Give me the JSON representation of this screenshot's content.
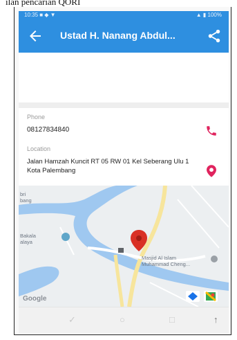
{
  "caption": "ılan pencarian QORI",
  "statusbar": {
    "left": "10:35 ■ ◆ ▼",
    "right": "▲ ▮ 100%"
  },
  "header": {
    "title": "Ustad H. Nanang Abdul...",
    "color": "#2e8fe0"
  },
  "details": {
    "phone_label": "Phone",
    "phone_value": "08127834840",
    "location_label": "Location",
    "location_value": "Jalan Hamzah Kuncit RT 05 RW 01 Kel Seberang Ulu 1 Kota Palembang",
    "accent": "#e0245e"
  },
  "map": {
    "label_left_top": "bri\nbang",
    "label_left_mid": "Bakala\nalaya",
    "label_mosque": "Masjid Al Islam\nMuhammad Cheng...",
    "google_logo": "Google",
    "water_color": "#9fc8f0",
    "road_color": "#f7e59c"
  },
  "navbar": {
    "icons": [
      "✓",
      "○",
      "□",
      "↑"
    ]
  }
}
